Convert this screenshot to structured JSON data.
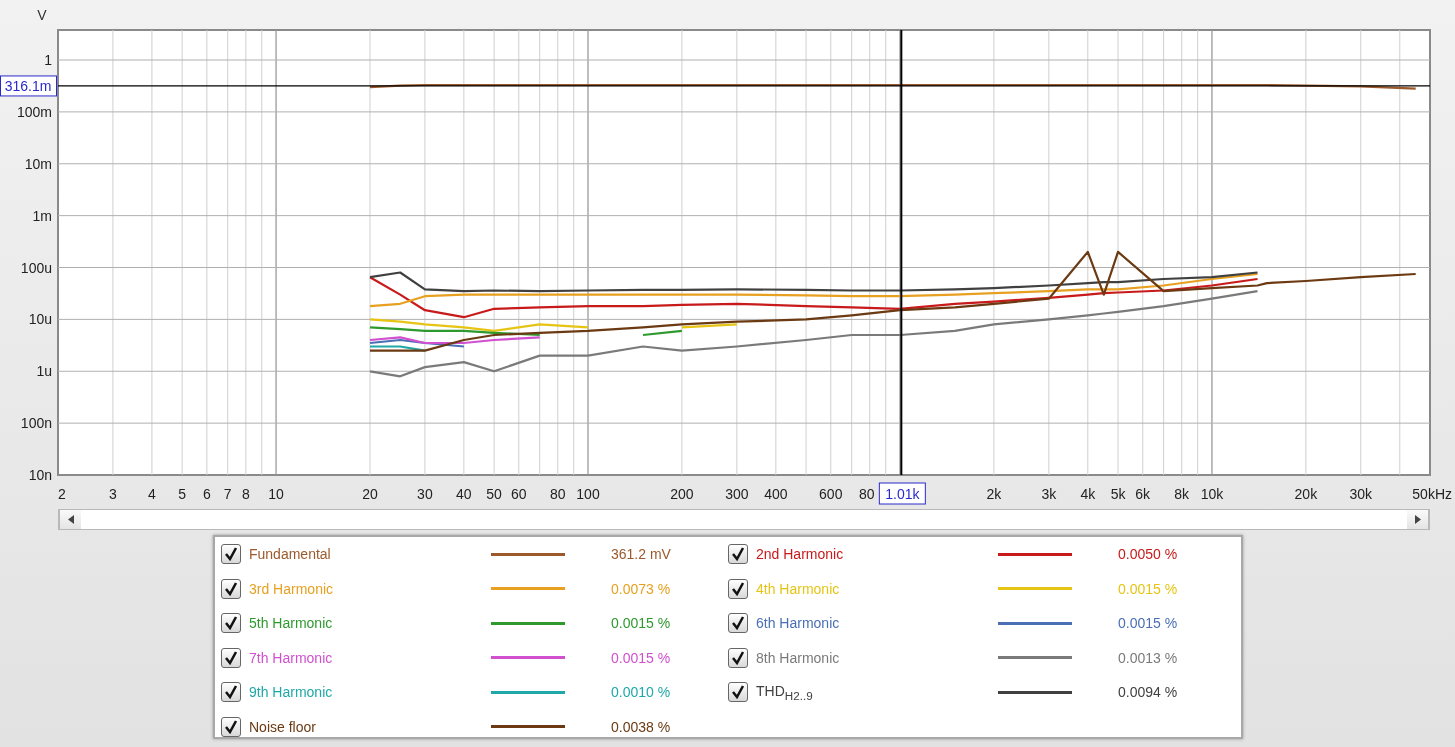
{
  "chart": {
    "y_unit": "V",
    "y_axis_labels": [
      "1",
      "100m",
      "10m",
      "1m",
      "100u",
      "10u",
      "1u",
      "100n",
      "10n"
    ],
    "x_axis_labels": [
      "2",
      "3",
      "4",
      "5",
      "6",
      "7",
      "8",
      "10",
      "20",
      "30",
      "40",
      "50",
      "60",
      "80",
      "100",
      "200",
      "300",
      "400",
      "600",
      "80",
      "2k",
      "3k",
      "4k",
      "5k",
      "6k",
      "8k",
      "10k",
      "20k",
      "30k",
      "50kHz"
    ],
    "cursor": {
      "x_readout": "1.01k",
      "y_readout": "316.1m"
    }
  },
  "legend": {
    "items": [
      {
        "label": "Fundamental",
        "checked": true,
        "color": "#9c5a2c",
        "value": "361.2 mV"
      },
      {
        "label": "2nd Harmonic",
        "checked": true,
        "color": "#c81a1a",
        "value": "0.0050 %"
      },
      {
        "label": "3rd Harmonic",
        "checked": true,
        "color": "#e8a020",
        "value": "0.0073 %"
      },
      {
        "label": "4th Harmonic",
        "checked": true,
        "color": "#e6c414",
        "value": "0.0015 %"
      },
      {
        "label": "5th Harmonic",
        "checked": true,
        "color": "#2e9a2e",
        "value": "0.0015 %"
      },
      {
        "label": "6th Harmonic",
        "checked": true,
        "color": "#4a6fb5",
        "value": "0.0015 %"
      },
      {
        "label": "7th Harmonic",
        "checked": true,
        "color": "#d050d0",
        "value": "0.0015 %"
      },
      {
        "label": "8th Harmonic",
        "checked": true,
        "color": "#7a7a7a",
        "value": "0.0013 %"
      },
      {
        "label": "9th Harmonic",
        "checked": true,
        "color": "#20a8a8",
        "value": "0.0010 %"
      },
      {
        "label": "THD$_{H2..9}$",
        "checked": true,
        "color": "#404040",
        "value": "0.0094 %"
      },
      {
        "label": "Noise floor",
        "checked": true,
        "color": "#6b3a12",
        "value": "0.0038 %"
      }
    ]
  }
}
